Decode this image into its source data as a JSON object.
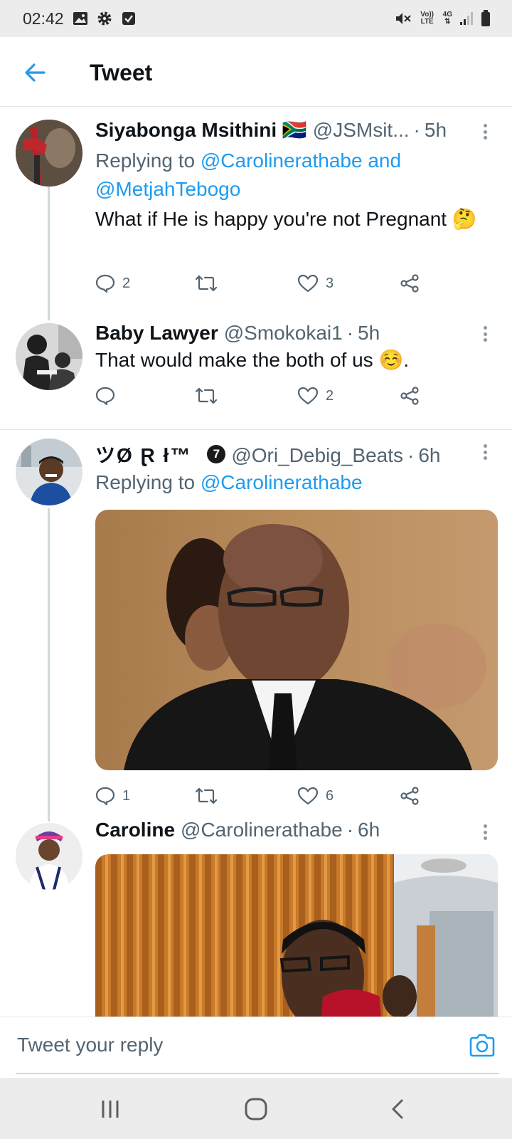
{
  "status_bar": {
    "time": "02:42",
    "left_icons": [
      "image-icon",
      "gear-icon",
      "checkbox-icon"
    ],
    "right_icons": [
      "mute-icon",
      "volte-icon",
      "4g-icon",
      "signal-icon",
      "battery-icon"
    ],
    "volte_label": "Vo)) LTE",
    "network_label": "4G"
  },
  "header": {
    "title": "Tweet"
  },
  "tweets": [
    {
      "name": "Siyabonga Msithini 🇿🇦",
      "handle": "@JSMsit...",
      "time": "5h",
      "replying_prefix": "Replying to",
      "replying_to": "@Carolinerathabe and @MetjahTebogo",
      "text": "What if He is happy you're not Pregnant 🤔",
      "replies": "2",
      "retweets": "",
      "likes": "3"
    },
    {
      "name": "Baby Lawyer",
      "handle": "@Smokokai1",
      "time": "5h",
      "text": "That would make the both of us ☺️.",
      "replies": "",
      "retweets": "",
      "likes": "2"
    },
    {
      "name": "ツØ Ɽ ł™",
      "badge": "7",
      "handle": "@Ori_Debig_Beats",
      "time": "6h",
      "replying_prefix": "Replying to",
      "replying_to": "@Carolinerathabe",
      "replies": "1",
      "retweets": "",
      "likes": "6"
    },
    {
      "name": "Caroline",
      "handle": "@Carolinerathabe",
      "time": "6h"
    }
  ],
  "reply_bar": {
    "placeholder": "Tweet your reply"
  },
  "colors": {
    "accent": "#1d9bf0",
    "muted": "#536471",
    "text": "#0f1419"
  }
}
